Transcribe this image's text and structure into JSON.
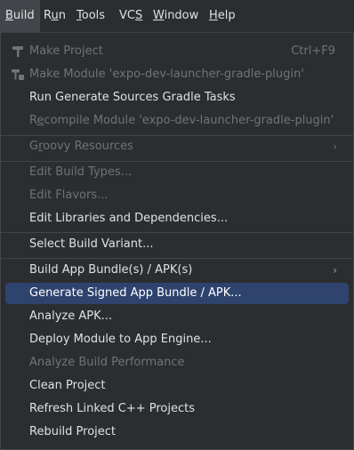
{
  "menubar": {
    "items": [
      {
        "label": "Build",
        "mnemonic": "B",
        "rest": "uild"
      },
      {
        "label": "Run",
        "pre": "R",
        "mnemonic": "u",
        "rest": "n"
      },
      {
        "label": "Tools",
        "mnemonic": "T",
        "rest": "ools"
      },
      {
        "label": "VCS",
        "pre": "VC",
        "mnemonic": "S",
        "rest": ""
      },
      {
        "label": "Window",
        "mnemonic": "W",
        "rest": "indow"
      },
      {
        "label": "Help",
        "mnemonic": "H",
        "rest": "elp"
      }
    ]
  },
  "menu": {
    "make_project": {
      "label": "Make Project",
      "shortcut": "Ctrl+F9"
    },
    "make_module": {
      "label": "Make Module 'expo-dev-launcher-gradle-plugin'"
    },
    "run_generate_sources": {
      "label": "Run Generate Sources Gradle Tasks"
    },
    "recompile_module": {
      "pre": "R",
      "mnemonic": "e",
      "rest": "compile Module 'expo-dev-launcher-gradle-plugin'"
    },
    "groovy_resources": {
      "pre": "G",
      "mnemonic": "r",
      "rest": "oovy Resources"
    },
    "edit_build_types": {
      "label": "Edit Build Types..."
    },
    "edit_flavors": {
      "label": "Edit Flavors..."
    },
    "edit_libraries": {
      "label": "Edit Libraries and Dependencies..."
    },
    "select_build_variant": {
      "label": "Select Build Variant..."
    },
    "build_app_bundle": {
      "label": "Build App Bundle(s) / APK(s)"
    },
    "generate_signed": {
      "label": "Generate Signed App Bundle / APK..."
    },
    "analyze_apk": {
      "label": "Analyze APK..."
    },
    "deploy_module": {
      "label": "Deploy Module to App Engine..."
    },
    "analyze_build_perf": {
      "label": "Analyze Build Performance"
    },
    "clean_project": {
      "label": "Clean Project"
    },
    "refresh_linked": {
      "label": "Refresh Linked C++ Projects"
    },
    "rebuild_project": {
      "label": "Rebuild Project"
    }
  },
  "icons": {
    "make_project": "hammer-icon",
    "make_module": "hammer-module-icon",
    "submenu": "chevron-right-icon"
  },
  "colors": {
    "background": "#2b2d30",
    "highlight": "#2e436e",
    "text": "#dfe1e5",
    "disabled_text": "#6f737a",
    "separator": "#43454a"
  }
}
